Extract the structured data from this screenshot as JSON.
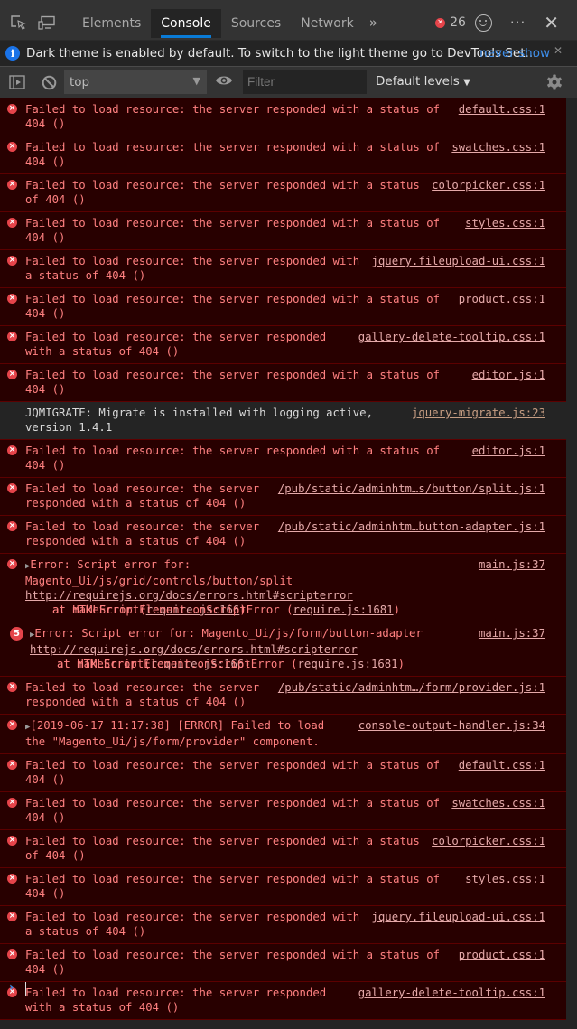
{
  "tabs": [
    {
      "label": "Elements",
      "active": false
    },
    {
      "label": "Console",
      "active": true
    },
    {
      "label": "Sources",
      "active": false
    },
    {
      "label": "Network",
      "active": false
    }
  ],
  "more_tabs_icon": "»",
  "error_count": "26",
  "infobar": {
    "text": "Dark theme is enabled by default. To switch to the light theme go to DevTools Set...",
    "link": "never show"
  },
  "toolbar": {
    "context": "top",
    "filter_placeholder": "Filter",
    "levels": "Default levels"
  },
  "colors": {
    "error_bg": "#280000",
    "error_text": "#ff8080",
    "accent": "#0a7bd6",
    "error_icon": "#e5444a"
  },
  "messages": [
    {
      "type": "error",
      "text": "Failed to load resource: the server responded with a status of 404 ()",
      "source": "default.css:1"
    },
    {
      "type": "error",
      "text": "Failed to load resource: the server responded with a status of 404 ()",
      "source": "swatches.css:1"
    },
    {
      "type": "error",
      "text": "Failed to load resource: the server responded with a status of 404 ()",
      "source": "colorpicker.css:1"
    },
    {
      "type": "error",
      "text": "Failed to load resource: the server responded with a status of 404 ()",
      "source": "styles.css:1"
    },
    {
      "type": "error",
      "text": "Failed to load resource: the server responded with a status of 404 ()",
      "source": "jquery.fileupload-ui.css:1"
    },
    {
      "type": "error",
      "text": "Failed to load resource: the server responded with a status of 404 ()",
      "source": "product.css:1"
    },
    {
      "type": "error",
      "text": "Failed to load resource: the server responded with a status of 404 ()",
      "source": "gallery-delete-tooltip.css:1"
    },
    {
      "type": "error",
      "text": "Failed to load resource: the server responded with a status of 404 ()",
      "source": "editor.js:1"
    },
    {
      "type": "info",
      "text": "JQMIGRATE: Migrate is installed with logging active, version 1.4.1",
      "source": "jquery-migrate.js:23"
    },
    {
      "type": "error",
      "text": "Failed to load resource: the server responded with a status of 404 ()",
      "source": "editor.js:1"
    },
    {
      "type": "error",
      "text": "Failed to load resource: the server responded with a status of 404 ()",
      "source": "/pub/static/adminhtm…s/button/split.js:1"
    },
    {
      "type": "error",
      "text": "Failed to load resource: the server responded with a status of 404 ()",
      "source": "/pub/static/adminhtm…button-adapter.js:1"
    },
    {
      "type": "error-expand",
      "head": "Error: Script error for:",
      "line2": "Magento_Ui/js/grid/controls/button/split",
      "url": "http://requirejs.org/docs/errors.html#scripterror",
      "stack1_pre": "at makeError (",
      "stack1_link": "require.js:166",
      "stack2_pre": "at HTMLScriptElement.onScriptError (",
      "stack2_link": "require.js:1681",
      "source": "main.js:37"
    },
    {
      "type": "error-group",
      "count": "5",
      "head": "Error: Script error for: Magento_Ui/js/form/button-adapter",
      "url": "http://requirejs.org/docs/errors.html#scripterror",
      "stack1_pre": "at makeError (",
      "stack1_link": "require.js:166",
      "stack2_pre": "at HTMLScriptElement.onScriptError (",
      "stack2_link": "require.js:1681",
      "source": "main.js:37"
    },
    {
      "type": "error",
      "text": "Failed to load resource: the server responded with a status of 404 ()",
      "source": "/pub/static/adminhtm…/form/provider.js:1"
    },
    {
      "type": "error-expand2",
      "text": "[2019-06-17 11:17:38] [ERROR] Failed to load the \"Magento_Ui/js/form/provider\" component.",
      "source": "console-output-handler.js:34"
    },
    {
      "type": "error",
      "text": "Failed to load resource: the server responded with a status of 404 ()",
      "source": "default.css:1"
    },
    {
      "type": "error",
      "text": "Failed to load resource: the server responded with a status of 404 ()",
      "source": "swatches.css:1"
    },
    {
      "type": "error",
      "text": "Failed to load resource: the server responded with a status of 404 ()",
      "source": "colorpicker.css:1"
    },
    {
      "type": "error",
      "text": "Failed to load resource: the server responded with a status of 404 ()",
      "source": "styles.css:1"
    },
    {
      "type": "error",
      "text": "Failed to load resource: the server responded with a status of 404 ()",
      "source": "jquery.fileupload-ui.css:1"
    },
    {
      "type": "error",
      "text": "Failed to load resource: the server responded with a status of 404 ()",
      "source": "product.css:1"
    },
    {
      "type": "error",
      "text": "Failed to load resource: the server responded with a status of 404 ()",
      "source": "gallery-delete-tooltip.css:1"
    }
  ]
}
